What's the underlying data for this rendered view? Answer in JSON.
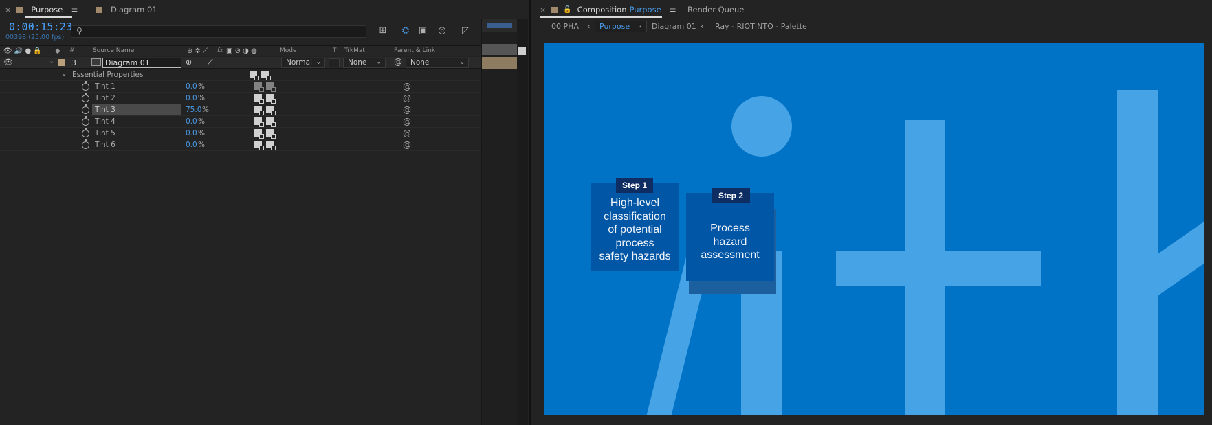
{
  "timeline_panel": {
    "tabs": [
      {
        "label": "Purpose",
        "swatch": "#a08a6b",
        "active": true
      },
      {
        "label": "Diagram 01",
        "swatch": "#a08a6b",
        "active": false
      }
    ],
    "timecode": "0:00:15:23",
    "frame_info": "00398 (25.00 fps)",
    "search": {
      "value": "",
      "placeholder": ""
    },
    "columns": {
      "num": "#",
      "source_name": "Source Name",
      "fx": "fx",
      "mode": "Mode",
      "t": "T",
      "trkmat": "TrkMat",
      "parent": "Parent & Link"
    },
    "layer": {
      "number": "3",
      "name": "Diagram 01",
      "label_color": "#b99f7a",
      "mode": "Normal",
      "trkmat": "None",
      "parent": "None"
    },
    "essential_properties_label": "Essential Properties",
    "properties": [
      {
        "name": "Tint 1",
        "value": "0.0",
        "unit": "%",
        "selected": false
      },
      {
        "name": "Tint 2",
        "value": "0.0",
        "unit": "%",
        "selected": false
      },
      {
        "name": "Tint 3",
        "value": "75.0",
        "unit": "%",
        "selected": true
      },
      {
        "name": "Tint 4",
        "value": "0.0",
        "unit": "%",
        "selected": false
      },
      {
        "name": "Tint 5",
        "value": "0.0",
        "unit": "%",
        "selected": false
      },
      {
        "name": "Tint 6",
        "value": "0.0",
        "unit": "%",
        "selected": false
      }
    ]
  },
  "composition_panel": {
    "tab_prefix": "Composition",
    "tab_comp_name": "Purpose",
    "render_queue_label": "Render Queue",
    "breadcrumbs": [
      "00 PHA",
      "Purpose",
      "Diagram 01",
      "Ray - RIOTINTO - Palette"
    ],
    "active_breadcrumb": "Purpose",
    "viewer": {
      "background": "#0073c7",
      "decor_color": "#45a3e6",
      "step1": {
        "tag": "Step 1",
        "lines": [
          "High-level",
          "classification",
          "of potential",
          "process",
          "safety hazards"
        ]
      },
      "step2": {
        "tag": "Step 2",
        "lines": [
          "Process",
          "hazard",
          "assessment"
        ]
      }
    }
  }
}
